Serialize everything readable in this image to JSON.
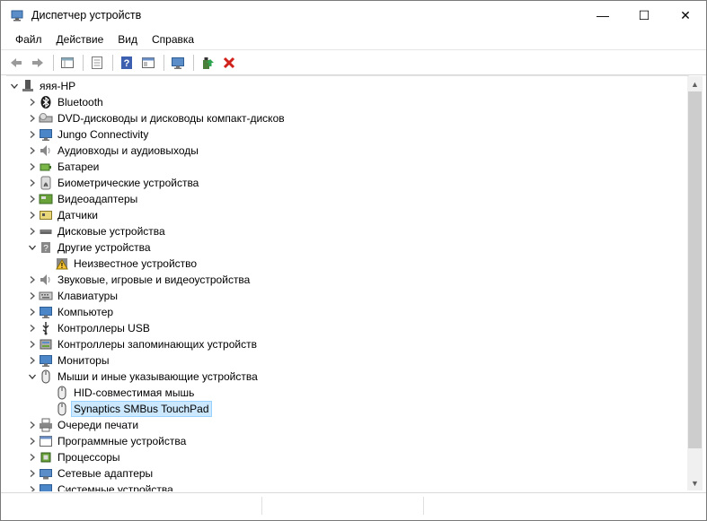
{
  "window": {
    "title": "Диспетчер устройств",
    "minimize": "—",
    "maximize": "☐",
    "close": "✕"
  },
  "menu": [
    "Файл",
    "Действие",
    "Вид",
    "Справка"
  ],
  "toolbar": [
    "back-icon",
    "forward-icon",
    "properties-grid-icon",
    "list-icon",
    "help-icon",
    "view-icon",
    "monitor-scan-icon",
    "update-driver-icon",
    "uninstall-icon"
  ],
  "tree": {
    "root": "яяя-HP",
    "items": [
      {
        "label": "Bluetooth",
        "icon": "bluetooth-icon",
        "level": 1,
        "expand": "collapsed"
      },
      {
        "label": "DVD-дисководы и дисководы компакт-дисков",
        "icon": "dvd-icon",
        "level": 1,
        "expand": "collapsed"
      },
      {
        "label": "Jungo Connectivity",
        "icon": "monitor-icon",
        "level": 1,
        "expand": "collapsed"
      },
      {
        "label": "Аудиовходы и аудиовыходы",
        "icon": "speaker-icon",
        "level": 1,
        "expand": "collapsed"
      },
      {
        "label": "Батареи",
        "icon": "battery-icon",
        "level": 1,
        "expand": "collapsed"
      },
      {
        "label": "Биометрические устройства",
        "icon": "fingerprint-icon",
        "level": 1,
        "expand": "collapsed"
      },
      {
        "label": "Видеоадаптеры",
        "icon": "display-adapter-icon",
        "level": 1,
        "expand": "collapsed"
      },
      {
        "label": "Датчики",
        "icon": "sensor-icon",
        "level": 1,
        "expand": "collapsed"
      },
      {
        "label": "Дисковые устройства",
        "icon": "disk-icon",
        "level": 1,
        "expand": "collapsed"
      },
      {
        "label": "Другие устройства",
        "icon": "unknown-device-icon",
        "level": 1,
        "expand": "expanded"
      },
      {
        "label": "Неизвестное устройство",
        "icon": "warning-device-icon",
        "level": 2,
        "expand": "none"
      },
      {
        "label": "Звуковые, игровые и видеоустройства",
        "icon": "speaker-icon",
        "level": 1,
        "expand": "collapsed"
      },
      {
        "label": "Клавиатуры",
        "icon": "keyboard-icon",
        "level": 1,
        "expand": "collapsed"
      },
      {
        "label": "Компьютер",
        "icon": "monitor-icon",
        "level": 1,
        "expand": "collapsed"
      },
      {
        "label": "Контроллеры USB",
        "icon": "usb-icon",
        "level": 1,
        "expand": "collapsed"
      },
      {
        "label": "Контроллеры запоминающих устройств",
        "icon": "storage-controller-icon",
        "level": 1,
        "expand": "collapsed"
      },
      {
        "label": "Мониторы",
        "icon": "monitor-icon",
        "level": 1,
        "expand": "collapsed"
      },
      {
        "label": "Мыши и иные указывающие устройства",
        "icon": "mouse-icon",
        "level": 1,
        "expand": "expanded"
      },
      {
        "label": "HID-совместимая мышь",
        "icon": "mouse-icon",
        "level": 2,
        "expand": "none"
      },
      {
        "label": "Synaptics SMBus TouchPad",
        "icon": "mouse-icon",
        "level": 2,
        "expand": "none",
        "selected": true
      },
      {
        "label": "Очереди печати",
        "icon": "printer-icon",
        "level": 1,
        "expand": "collapsed"
      },
      {
        "label": "Программные устройства",
        "icon": "software-device-icon",
        "level": 1,
        "expand": "collapsed"
      },
      {
        "label": "Процессоры",
        "icon": "processor-icon",
        "level": 1,
        "expand": "collapsed"
      },
      {
        "label": "Сетевые адаптеры",
        "icon": "network-adapter-icon",
        "level": 1,
        "expand": "collapsed"
      },
      {
        "label": "Системные устройства",
        "icon": "system-device-icon",
        "level": 1,
        "expand": "collapsed"
      }
    ]
  },
  "colors": {
    "selection": "#cce8ff",
    "selection_border": "#99d1ff",
    "scroll_thumb": "#cdcdcd"
  }
}
